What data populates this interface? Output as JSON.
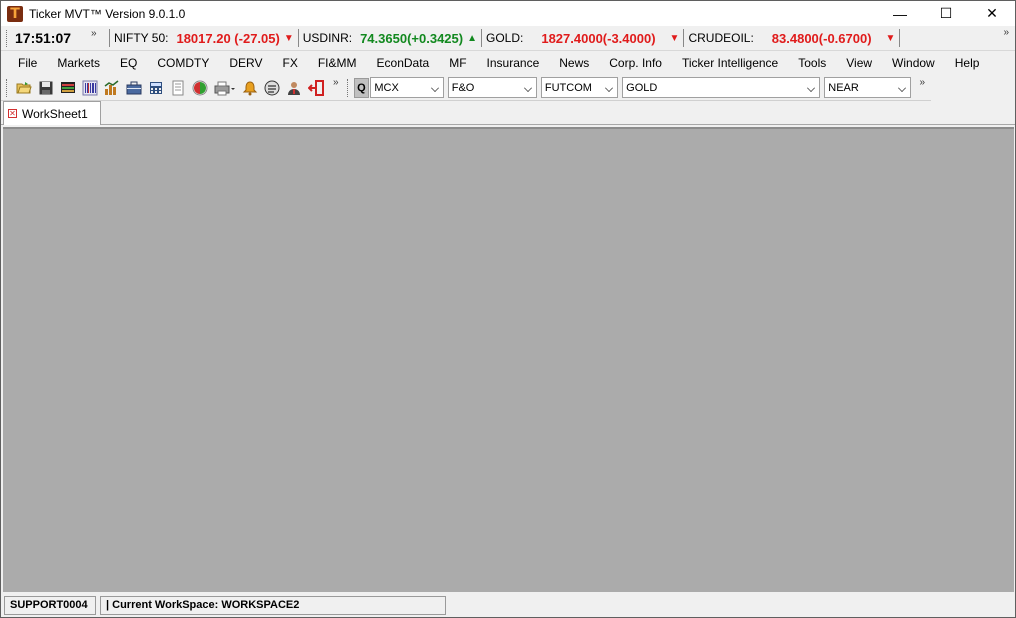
{
  "window": {
    "title": "Ticker MVT™  Version  9.0.1.0",
    "logo_letter": "T",
    "controls": {
      "minimize": "—",
      "maximize": "☐",
      "close": "✕"
    }
  },
  "ticker": {
    "time": "17:51:07",
    "items": [
      {
        "label": "NIFTY 50:",
        "value": "18017.20 (-27.05)",
        "direction": "down"
      },
      {
        "label": "USDINR:",
        "value": "74.3650(+0.3425)",
        "direction": "up"
      },
      {
        "label": "GOLD:",
        "value": "1827.4000(-3.4000)",
        "direction": "down"
      },
      {
        "label": "CRUDEOIL:",
        "value": "83.4800(-0.6700)",
        "direction": "down"
      }
    ],
    "more": "»",
    "colors": {
      "down": "#e01b1b",
      "up": "#12891f"
    }
  },
  "menu": {
    "items": [
      "File",
      "Markets",
      "EQ",
      "COMDTY",
      "DERV",
      "FX",
      "FI&MM",
      "EconData",
      "MF",
      "Insurance",
      "News",
      "Corp. Info",
      "Ticker Intelligence",
      "Tools",
      "View",
      "Window",
      "Help"
    ]
  },
  "toolbar": {
    "icons": [
      "open-folder-icon",
      "save-icon",
      "monitor-icon",
      "barcode-chart-icon",
      "bar-chart-icon",
      "briefcase-icon",
      "calculator-icon",
      "document-icon",
      "flag-icon",
      "printer-icon",
      "bell-icon",
      "news-icon",
      "user-icon",
      "exit-icon"
    ],
    "more": "»",
    "quote_label": "Q",
    "exchange": "MCX",
    "segment": "F&O",
    "instrument": "FUTCOM",
    "symbol": "GOLD",
    "expiry": "NEAR",
    "more_right": "»"
  },
  "tabs": [
    {
      "label": "WorkSheet1"
    }
  ],
  "status": {
    "user": "SUPPORT0004",
    "workspace": "| Current WorkSpace: WORKSPACE2"
  }
}
